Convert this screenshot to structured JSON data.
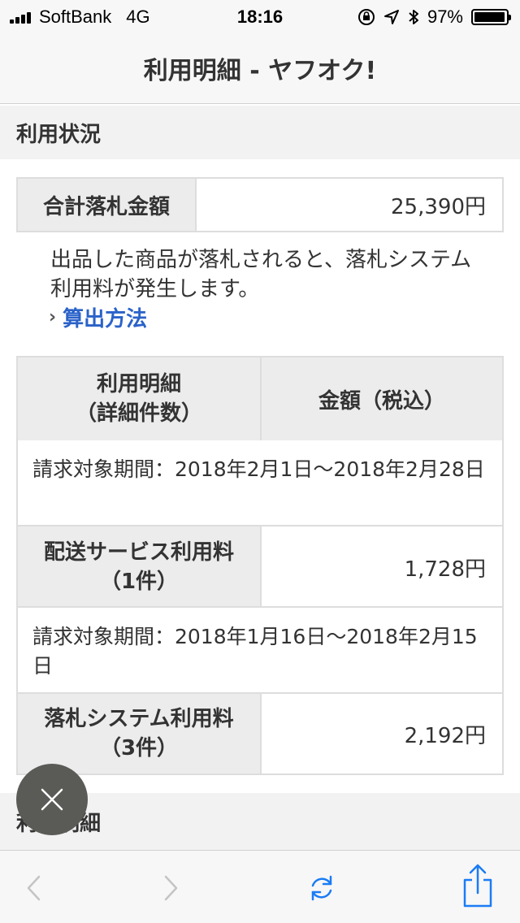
{
  "status_bar": {
    "carrier": "SoftBank",
    "network": "4G",
    "time": "18:16",
    "battery": "97%",
    "battery_level": 0.97,
    "icons": [
      "signal-icon",
      "orientation-lock-icon",
      "location-icon",
      "bluetooth-icon",
      "battery-icon"
    ]
  },
  "nav": {
    "title": "利用明細 - ヤフオク!"
  },
  "usage_section": {
    "heading": "利用状況"
  },
  "total": {
    "label": "合計落札金額",
    "value": "25,390円"
  },
  "note": {
    "text": "出品した商品が落札されると、落札システム利用料が発生します。"
  },
  "calc_link": {
    "label": "算出方法",
    "icon": "chevron-right-icon"
  },
  "detail_table": {
    "header": {
      "col1_line1": "利用明細",
      "col1_line2": "（詳細件数）",
      "col2": "金額（税込）"
    },
    "periods": [
      {
        "period_text": "請求対象期間：2018年2月1日〜2018年2月28日",
        "fee_line1": "配送サービス利用料",
        "fee_line2": "（1件）",
        "amount": "1,728円"
      },
      {
        "period_text": "請求対象期間：2018年1月16日〜2018年2月15日",
        "fee_line1": "落札システム利用料",
        "fee_line2": "（3件）",
        "amount": "2,192円"
      }
    ]
  },
  "detail_section": {
    "heading": "利用明細"
  },
  "fab": {
    "icon": "close-icon"
  },
  "toolbar": {
    "icons": [
      "back-icon",
      "forward-icon",
      "reload-icon",
      "share-icon"
    ],
    "accent": "#1a7cf5"
  }
}
